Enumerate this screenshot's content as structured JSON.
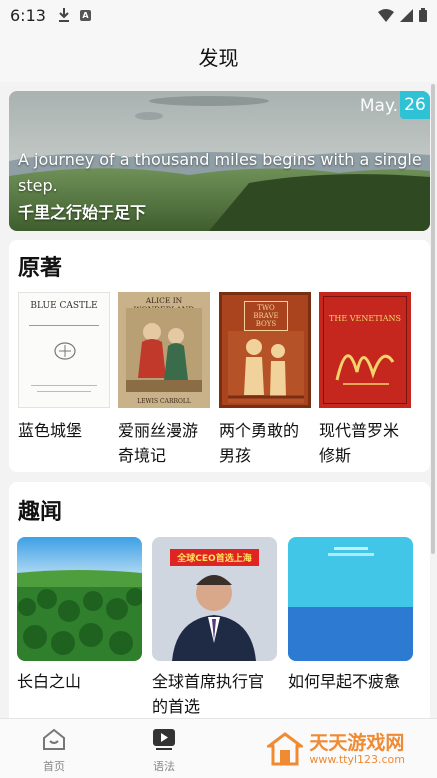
{
  "status_bar": {
    "time": "6:13"
  },
  "header": {
    "title": "发现"
  },
  "banner": {
    "month": "May.",
    "day": "26",
    "quote_en": "A journey of a thousand miles begins with a single step.",
    "quote_zh": "千里之行始于足下"
  },
  "books_section": {
    "title": "原著",
    "items": [
      {
        "title": "蓝色城堡",
        "cover_text": "BLUE CASTLE"
      },
      {
        "title": "爱丽丝漫游奇境记",
        "cover_text": "ALICE IN WONDERLAND",
        "cover_sub": "LEWIS CARROLL"
      },
      {
        "title": "两个勇敢的男孩",
        "cover_text": "TWO BRAVE BOYS"
      },
      {
        "title": "现代普罗米修斯",
        "cover_text": "THE VENETIANS"
      }
    ]
  },
  "news_section": {
    "title": "趣闻",
    "items": [
      {
        "title": "长白之山"
      },
      {
        "title": "全球首席执行官的首选",
        "thumb_text": "全球CEO首选上海"
      },
      {
        "title": "如何早起不疲惫"
      }
    ]
  },
  "bottom_nav": {
    "items": [
      {
        "label": "首页",
        "icon": "home-icon"
      },
      {
        "label": "语法",
        "icon": "play-icon"
      }
    ]
  },
  "watermark": {
    "text": "天天游戏网",
    "url": "www.ttyl123.com"
  },
  "colors": {
    "accent": "#2fc2d4",
    "watermark": "#f08a33"
  }
}
